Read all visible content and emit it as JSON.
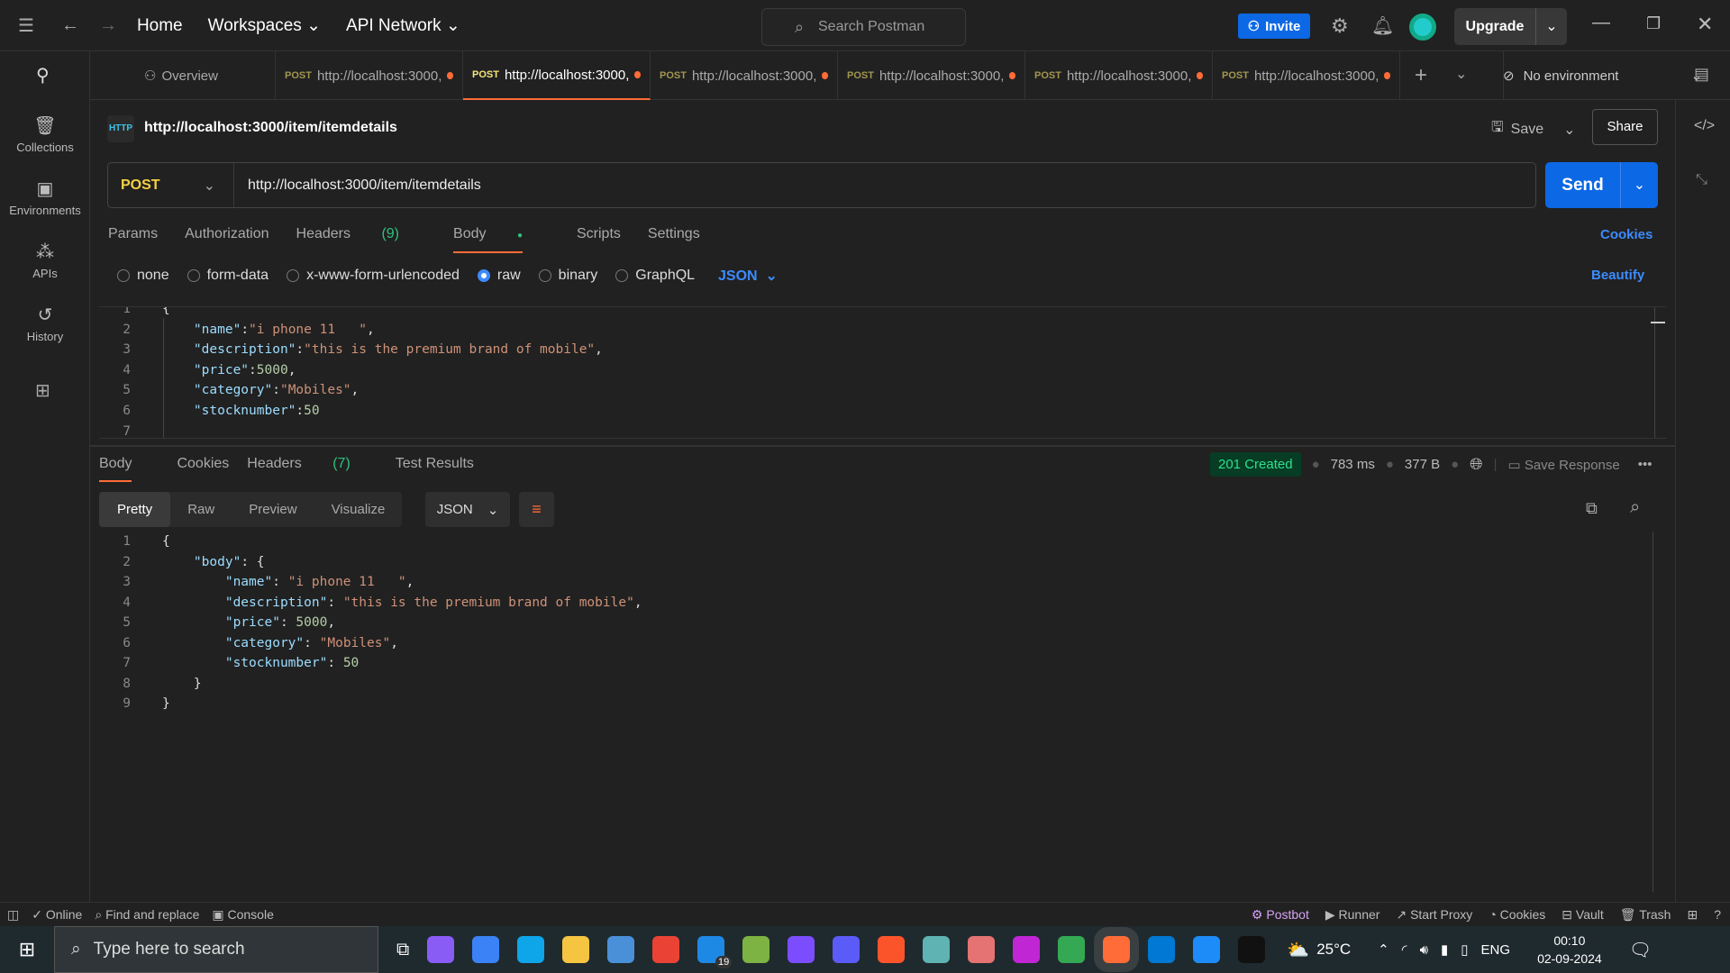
{
  "titlebar": {
    "home": "Home",
    "workspaces": "Workspaces",
    "api_network": "API Network",
    "search_placeholder": "Search Postman",
    "invite": "Invite",
    "upgrade": "Upgrade"
  },
  "sidebar": [
    {
      "label": "Collections",
      "icon": "collections-icon"
    },
    {
      "label": "Environments",
      "icon": "environments-icon"
    },
    {
      "label": "APIs",
      "icon": "apis-icon"
    },
    {
      "label": "History",
      "icon": "history-icon"
    }
  ],
  "tabs": {
    "overview": "Overview",
    "items": [
      {
        "method": "POST",
        "url": "http://localhost:3000,"
      },
      {
        "method": "POST",
        "url": "http://localhost:3000,",
        "active": true
      },
      {
        "method": "POST",
        "url": "http://localhost:3000,"
      },
      {
        "method": "POST",
        "url": "http://localhost:3000,"
      },
      {
        "method": "POST",
        "url": "http://localhost:3000,"
      },
      {
        "method": "POST",
        "url": "http://localhost:3000,"
      }
    ],
    "environment": "No environment"
  },
  "request": {
    "title": "http://localhost:3000/item/itemdetails",
    "save": "Save",
    "share": "Share",
    "method": "POST",
    "url": "http://localhost:3000/item/itemdetails",
    "send": "Send",
    "tabs": [
      "Params",
      "Authorization",
      "Headers",
      "Body",
      "Scripts",
      "Settings"
    ],
    "headers_count": "(9)",
    "cookies": "Cookies",
    "body_types": [
      "none",
      "form-data",
      "x-www-form-urlencoded",
      "raw",
      "binary",
      "GraphQL"
    ],
    "selected_body_type": "raw",
    "format": "JSON",
    "beautify": "Beautify",
    "body_lines": [
      "{",
      "    \"name\":\"i phone 11   \",",
      "    \"description\":\"this is the premium brand of mobile\",",
      "    \"price\":5000,",
      "    \"category\":\"Mobiles\",",
      "    \"stocknumber\":50",
      ""
    ]
  },
  "response": {
    "tabs": [
      "Body",
      "Cookies",
      "Headers",
      "Test Results"
    ],
    "headers_count": "(7)",
    "status": "201 Created",
    "time": "783 ms",
    "size": "377 B",
    "save_response": "Save Response",
    "views": [
      "Pretty",
      "Raw",
      "Preview",
      "Visualize"
    ],
    "format": "JSON",
    "lines": [
      "{",
      "    \"body\": {",
      "        \"name\": \"i phone 11   \",",
      "        \"description\": \"this is the premium brand of mobile\",",
      "        \"price\": 5000,",
      "        \"category\": \"Mobiles\",",
      "        \"stocknumber\": 50",
      "    }",
      "}"
    ]
  },
  "statusbar": {
    "online": "Online",
    "find": "Find and replace",
    "console": "Console",
    "postbot": "Postbot",
    "runner": "Runner",
    "proxy": "Start Proxy",
    "cookies": "Cookies",
    "vault": "Vault",
    "trash": "Trash"
  },
  "taskbar": {
    "search_placeholder": "Type here to search",
    "temperature": "25°C",
    "language": "ENG",
    "time": "00:10",
    "date": "02-09-2024",
    "mail_badge": "19",
    "apps": [
      {
        "name": "copilot",
        "color": "#8a5cf6"
      },
      {
        "name": "store",
        "color": "#3b82f6"
      },
      {
        "name": "edge",
        "color": "#0ea5e9"
      },
      {
        "name": "explorer",
        "color": "#f5c542"
      },
      {
        "name": "app",
        "color": "#4a90d9"
      },
      {
        "name": "chrome",
        "color": "#ea4335"
      },
      {
        "name": "mail",
        "color": "#1e88e5"
      },
      {
        "name": "git-app",
        "color": "#7cb342"
      },
      {
        "name": "app2",
        "color": "#7c4dff"
      },
      {
        "name": "app3",
        "color": "#5b5bf7"
      },
      {
        "name": "brave",
        "color": "#fb542b"
      },
      {
        "name": "app4",
        "color": "#5fb3b3"
      },
      {
        "name": "player",
        "color": "#e57373"
      },
      {
        "name": "github",
        "color": "#c026d3"
      },
      {
        "name": "chrome2",
        "color": "#34a853"
      },
      {
        "name": "postman",
        "color": "#ff6c37"
      },
      {
        "name": "vscode",
        "color": "#0078d4"
      },
      {
        "name": "docker",
        "color": "#1d8cf8"
      },
      {
        "name": "terminal",
        "color": "#111111"
      }
    ]
  }
}
